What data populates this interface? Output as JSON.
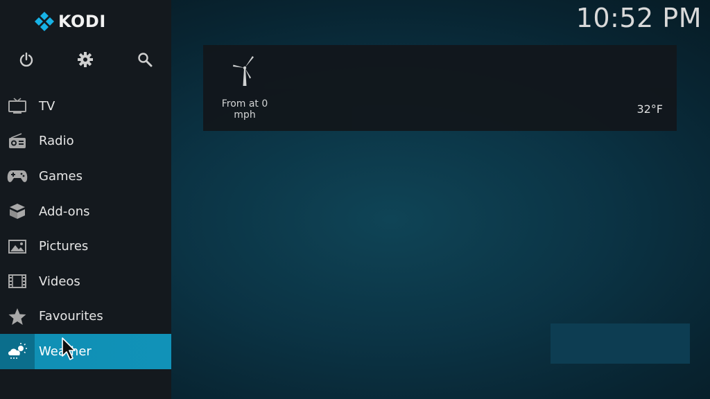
{
  "app": {
    "title": "KODI"
  },
  "clock": "10:52 PM",
  "top_icons": [
    {
      "name": "power-icon"
    },
    {
      "name": "gear-icon"
    },
    {
      "name": "search-icon"
    }
  ],
  "menu": {
    "items": [
      {
        "label": "TV",
        "icon": "tv-icon"
      },
      {
        "label": "Radio",
        "icon": "radio-icon"
      },
      {
        "label": "Games",
        "icon": "gamepad-icon"
      },
      {
        "label": "Add-ons",
        "icon": "box-icon"
      },
      {
        "label": "Pictures",
        "icon": "picture-icon"
      },
      {
        "label": "Videos",
        "icon": "film-icon"
      },
      {
        "label": "Favourites",
        "icon": "star-icon"
      },
      {
        "label": "Weather",
        "icon": "weather-icon",
        "active": true
      }
    ]
  },
  "weather": {
    "wind_text": "From  at 0 mph",
    "temperature": "32°F"
  },
  "colors": {
    "accent": "#1192b8",
    "sidebar": "#14191e"
  }
}
